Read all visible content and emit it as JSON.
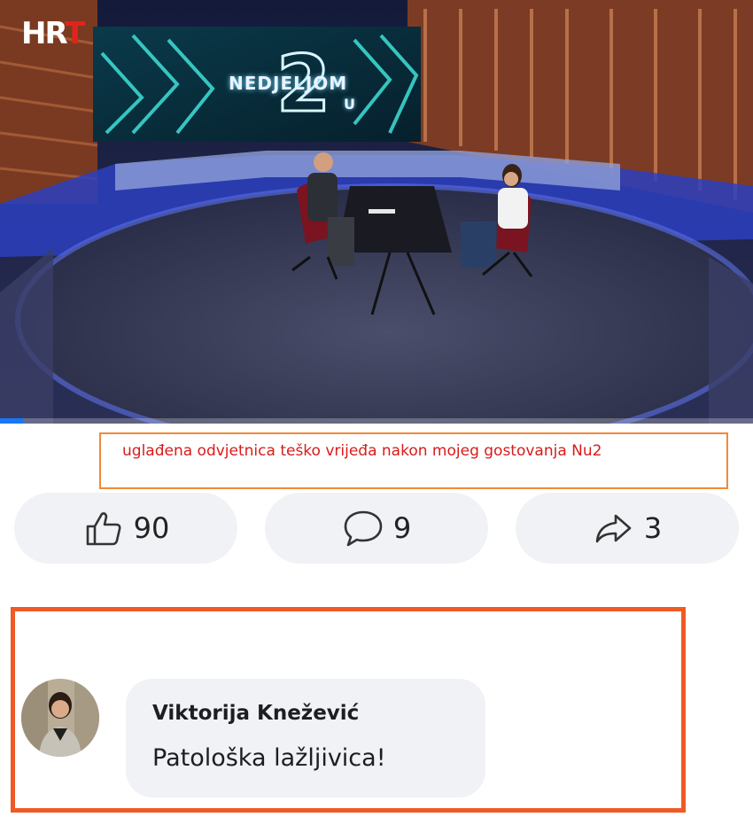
{
  "video": {
    "channel_logo": "HRT",
    "show_title": "NEDJELJOM",
    "show_number": "2",
    "show_suffix": "U",
    "progress": 0.03,
    "accent_color": "#1877f2"
  },
  "caption": {
    "text": "uglađena odvjetnica teško vrijeđa nakon mojeg gostovanja Nu2",
    "color": "#d81b1b",
    "border_color": "#f08a3a"
  },
  "actions": {
    "like": {
      "icon": "thumbs-up-icon",
      "count": "90"
    },
    "comment": {
      "icon": "comment-bubble-icon",
      "count": "9"
    },
    "share": {
      "icon": "share-arrow-icon",
      "count": "3"
    }
  },
  "comment": {
    "author": "Viktorija Knežević",
    "text": "Patološka lažljivica!",
    "frame_color": "#f05a24"
  }
}
